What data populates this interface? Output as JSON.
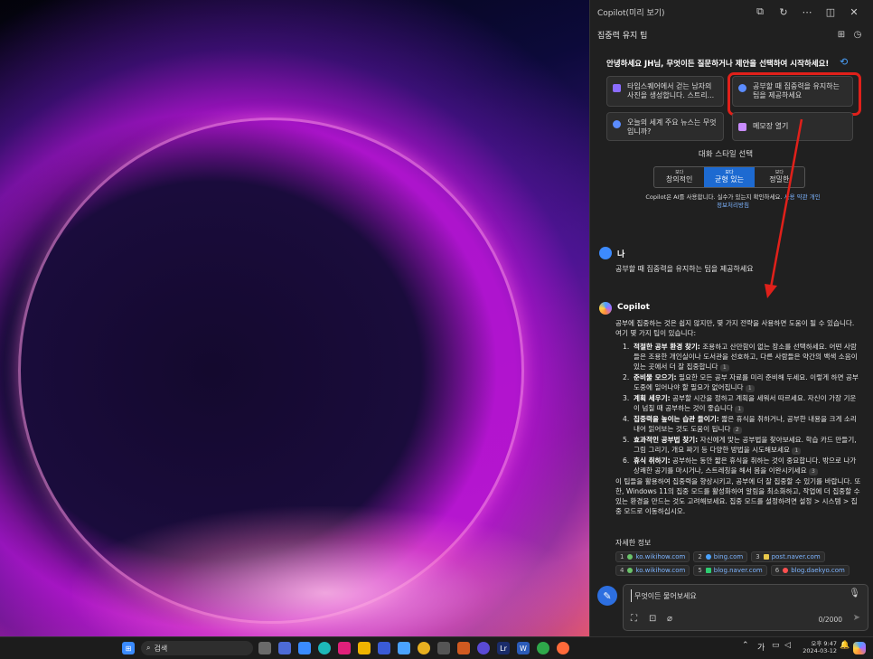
{
  "window": {
    "title": "Copilot(미리 보기)",
    "topic": "집중력 유지 팁"
  },
  "intro": {
    "greeting": "안녕하세요 JH님, 무엇이든 질문하거나 제안을 선택하여 시작하세요!"
  },
  "suggestions": [
    {
      "text": "타임스퀘어에서 걷는 남자의 사진을 생성합니다. 스트리...",
      "icon": "image-icon",
      "color": "#8b6cff"
    },
    {
      "text": "공부할 때 집중력을 유지하는 팁을 제공하세요",
      "icon": "copilot-chat-icon",
      "color": "#5b8cff"
    },
    {
      "text": "오늘의 세계 주요 뉴스는 무엇입니까?",
      "icon": "copilot-chat-icon",
      "color": "#5b8cff"
    },
    {
      "text": "메모장 열기",
      "icon": "sparkle-icon",
      "color": "#c98cff"
    }
  ],
  "conversation_style": {
    "label": "대화 스타일 선택",
    "options": [
      {
        "small": "보다",
        "label": "창의적인",
        "active": false
      },
      {
        "small": "보다",
        "label": "균형 있는",
        "active": true
      },
      {
        "small": "보다",
        "label": "정밀한",
        "active": false
      }
    ]
  },
  "disclaimer": {
    "text": "Copilot은 AI를 사용합니다. 실수가 있는지 확인하세요.",
    "terms": "사용 약관",
    "privacy": "개인정보처리방침"
  },
  "user_message": {
    "speaker": "나",
    "text": "공부할 때 집중력을 유지하는 팁을 제공하세요"
  },
  "copilot_message": {
    "speaker": "Copilot",
    "intro": "공부에 집중하는 것은 쉽지 않지만, 몇 가지 전략을 사용하면 도움이 될 수 있습니다. 여기 몇 가지 팁이 있습니다:",
    "tips": [
      {
        "num": "1.",
        "title": "적절한 공부 환경 찾기:",
        "body": "조용하고 산만함이 없는 장소를 선택하세요. 어떤 사람들은 조용한 개인실이나 도서관을 선호하고, 다른 사람들은 약간의 백색 소음이 있는 곳에서 더 잘 집중합니다",
        "cite": "1"
      },
      {
        "num": "2.",
        "title": "준비물 모으기:",
        "body": "필요한 모든 공부 자료를 미리 준비해 두세요. 이렇게 하면 공부 도중에 일어나야 할 필요가 없어집니다",
        "cite": "1"
      },
      {
        "num": "3.",
        "title": "계획 세우기:",
        "body": "공부할 시간을 정하고 계획을 세워서 따르세요. 자신이 가장 기운이 넘칠 때 공부하는 것이 좋습니다",
        "cite": "1"
      },
      {
        "num": "4.",
        "title": "집중력을 높이는 습관 들이기:",
        "body": "짧은 휴식을 취하거나, 공부한 내용을 크게 소리 내어 읽어보는 것도 도움이 됩니다",
        "cite": "2"
      },
      {
        "num": "5.",
        "title": "효과적인 공부법 찾기:",
        "body": "자신에게 맞는 공부법을 찾아보세요. 학습 카드 만들기, 그림 그리기, 개요 짜기 등 다양한 방법을 시도해보세요",
        "cite": "1"
      },
      {
        "num": "6.",
        "title": "휴식 취하기:",
        "body": "공부하는 동안 짧은 휴식을 취하는 것이 중요합니다. 밖으로 나가 상쾌한 공기를 마시거나, 스트레칭을 해서 몸을 이완시키세요",
        "cite": "3"
      }
    ],
    "closing": "이 팁들을 활용하여 집중력을 향상시키고, 공부에 더 잘 집중할 수 있기를 바랍니다. 또한, Windows 11의 집중 모드를 활성화하여 알림을 최소화하고, 작업에 더 집중할 수 있는 환경을 만드는 것도 고려해보세요. 집중 모드를 설정하려면 설정 > 시스템 > 집중 모드로 이동하십시오."
  },
  "sources": {
    "label": "자세한 정보",
    "items": [
      {
        "n": "1",
        "site": "ko.wikihow.com",
        "color": "#6ac36a"
      },
      {
        "n": "2",
        "site": "bing.com",
        "color": "#4aa3ff"
      },
      {
        "n": "3",
        "site": "post.naver.com",
        "color": "#e8c84a"
      },
      {
        "n": "4",
        "site": "ko.wikihow.com",
        "color": "#6ac36a"
      },
      {
        "n": "5",
        "site": "blog.naver.com",
        "color": "#2ecc71"
      },
      {
        "n": "6",
        "site": "blog.daekyo.com",
        "color": "#ff5050"
      }
    ]
  },
  "composer": {
    "placeholder": "무엇이든 물어보세요",
    "char_count": "0/2000"
  },
  "taskbar": {
    "search_label": "검색",
    "clock_time": "오후 9:47",
    "clock_date": "2024-03-12",
    "ime": "가"
  },
  "colors": {
    "accent": "#1d6ad1",
    "highlight_box": "#e0201a",
    "arrow": "#e0201a"
  }
}
